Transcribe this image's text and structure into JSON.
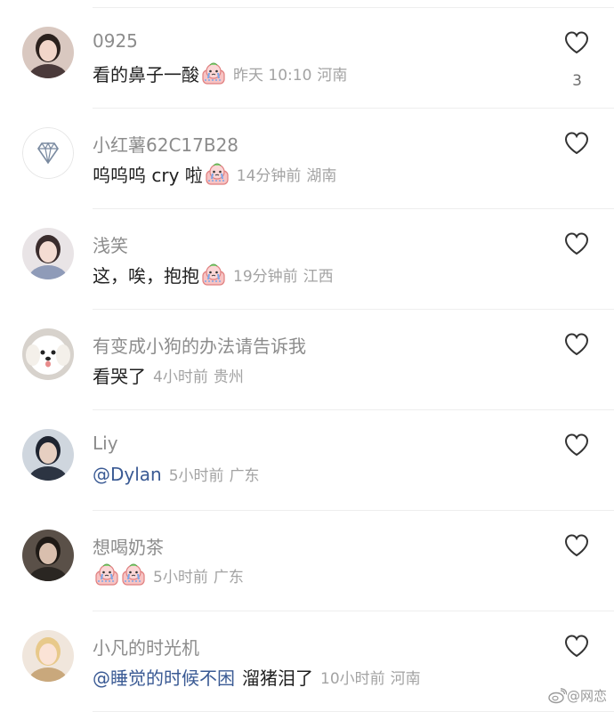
{
  "comments": [
    {
      "username": "0925",
      "text": "看的鼻子一酸",
      "emoji_count": 1,
      "time": "昨天 10:10",
      "location": "河南",
      "likes": "3",
      "mention": false,
      "avatar": "avatar-woman-dark-hair"
    },
    {
      "username": "小红薯62C17B28",
      "text": "呜呜呜 cry 啦",
      "emoji_count": 1,
      "time": "14分钟前",
      "location": "湖南",
      "likes": "",
      "mention": false,
      "avatar": "diamond-icon"
    },
    {
      "username": "浅笑",
      "text": "这，唉，抱抱",
      "emoji_count": 1,
      "time": "19分钟前",
      "location": "江西",
      "likes": "",
      "mention": false,
      "avatar": "avatar-woman-costume"
    },
    {
      "username": "有变成小狗的办法请告诉我",
      "text": "看哭了",
      "emoji_count": 0,
      "time": "4小时前",
      "location": "贵州",
      "likes": "",
      "mention": false,
      "avatar": "avatar-white-dog"
    },
    {
      "username": "Liy",
      "text": "@Dylan",
      "emoji_count": 0,
      "time": "5小时前",
      "location": "广东",
      "likes": "",
      "mention": true,
      "avatar": "avatar-boy-cap"
    },
    {
      "username": "想喝奶茶",
      "text": "",
      "emoji_count": 2,
      "time": "5小时前",
      "location": "广东",
      "likes": "",
      "mention": false,
      "avatar": "avatar-person-dark"
    },
    {
      "username": "小凡的时光机",
      "text": "@睡觉的时候不困",
      "text_after": "溜猪泪了",
      "emoji_count": 0,
      "time": "10小时前",
      "location": "河南",
      "likes": "",
      "mention": true,
      "avatar": "avatar-cartoon-doll"
    }
  ],
  "emoji_name": "crying-face-sticker",
  "like_icon": "heart-outline-icon",
  "watermark": {
    "text": "@网恋",
    "icon": "weibo-icon"
  },
  "colors": {
    "username": "#8c8c8c",
    "text": "#1f1f1f",
    "meta": "#a3a3a3",
    "mention": "#3a5a94",
    "emoji_pink": "#f3a6a6",
    "emoji_tear": "#8fb4e8"
  }
}
